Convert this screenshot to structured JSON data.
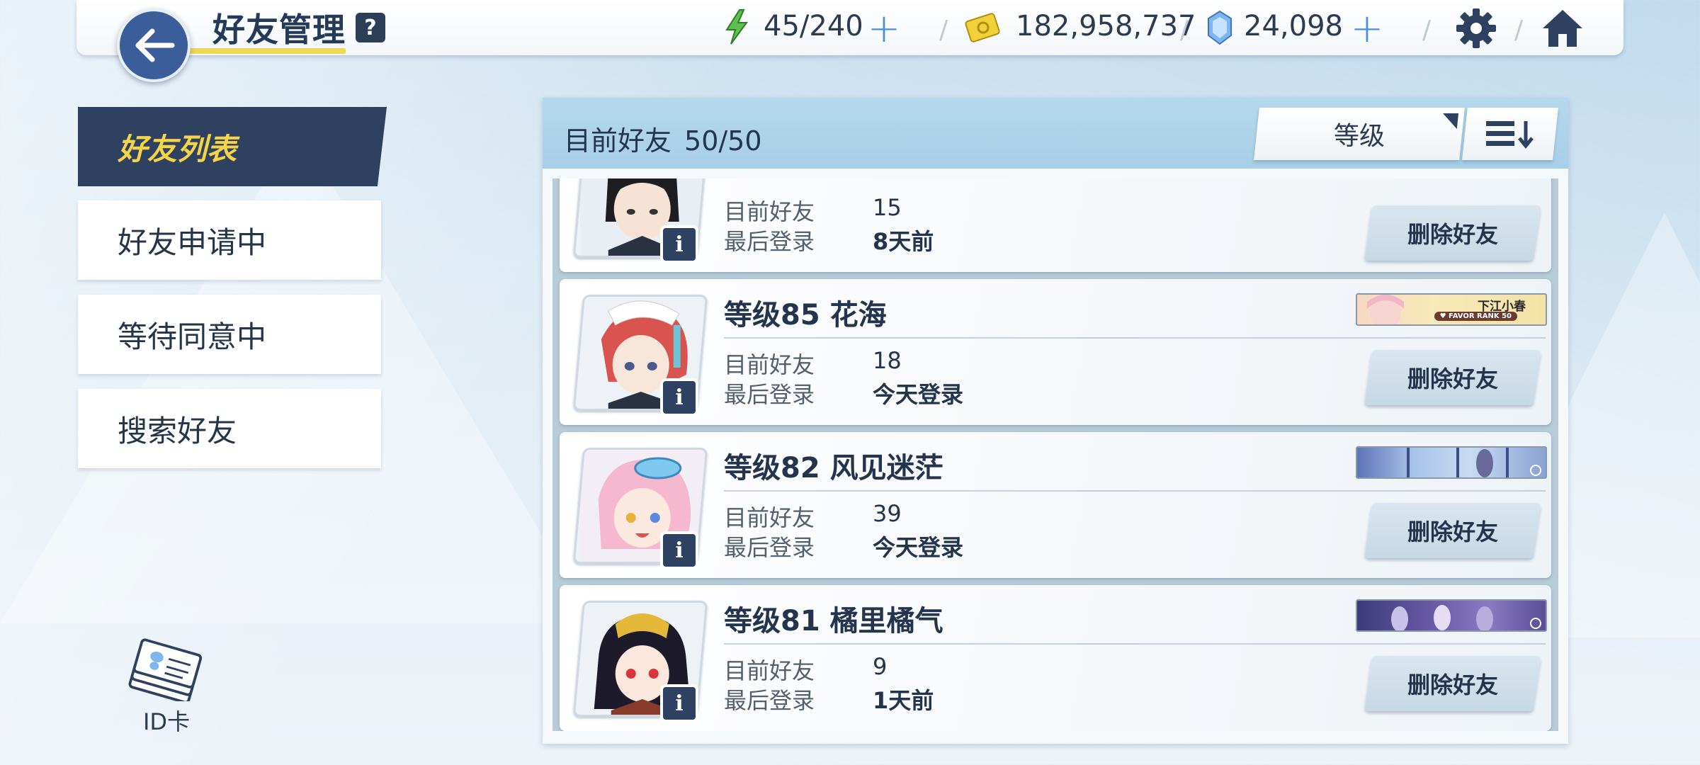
{
  "header": {
    "title": "好友管理",
    "help": "?",
    "stamina": "45/240",
    "credits": "182,958,737",
    "gems": "24,098"
  },
  "sidebar": {
    "items": [
      {
        "label": "好友列表",
        "active": true
      },
      {
        "label": "好友申请中"
      },
      {
        "label": "等待同意中"
      },
      {
        "label": "搜索好友"
      }
    ],
    "id_card": "ID卡"
  },
  "panel": {
    "title": "目前好友",
    "count": "50/50",
    "sort_label": "等级"
  },
  "labels": {
    "friends": "目前好友",
    "last_login": "最后登录",
    "delete": "删除好友",
    "info": "i"
  },
  "friends": [
    {
      "name": "",
      "friends": "15",
      "last_login": "8天前"
    },
    {
      "name": "等级85 花海",
      "friends": "18",
      "last_login": "今天登录",
      "banner_title": "下江小春",
      "banner_sub": "♥ FAVOR RANK 50"
    },
    {
      "name": "等级82 风见迷茫",
      "friends": "39",
      "last_login": "今天登录"
    },
    {
      "name": "等级81 橘里橘气",
      "friends": "9",
      "last_login": "1天前"
    }
  ],
  "colors": {
    "navy": "#2e4160",
    "accent_yellow": "#f5d448",
    "plus_blue": "#4a90d9",
    "header_blue": "#a7cfe7"
  }
}
